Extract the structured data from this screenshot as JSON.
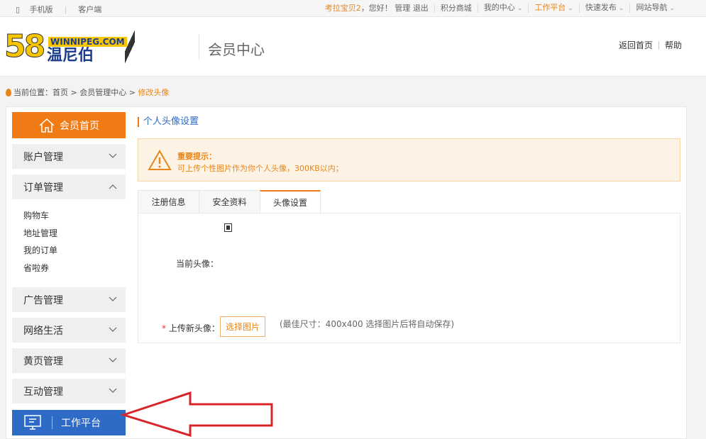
{
  "topbar": {
    "mobile": "手机版",
    "client": "客户端",
    "user": "考拉宝贝2",
    "greeting": "，您好！",
    "manage": "管理",
    "logout": "退出",
    "points": "积分商城",
    "mycenter": "我的中心",
    "workspace": "工作平台",
    "quickpost": "快速发布",
    "sitenav": "网站导航"
  },
  "header": {
    "logo_num": "58",
    "logo_web": "WINNIPEG.COM",
    "logo_cn": "温尼伯",
    "title": "会员中心",
    "home": "返回首页",
    "help": "帮助"
  },
  "breadcrumb": {
    "prefix": "当前位置：",
    "home": "首页",
    "center": "会员管理中心",
    "current": "修改头像"
  },
  "sidebar": {
    "home": "会员首页",
    "account": "账户管理",
    "orders": "订单管理",
    "order_items": [
      "购物车",
      "地址管理",
      "我的订单",
      "省啦券"
    ],
    "ads": "广告管理",
    "netlife": "网络生活",
    "yellow": "黄页管理",
    "interact": "互动管理",
    "work": "工作平台"
  },
  "content": {
    "section_title": "个人头像设置",
    "notice_title": "重要提示：",
    "notice_text": "可上传个性图片作为你个人头像，300KB以内；",
    "tabs": [
      "注册信息",
      "安全资料",
      "头像设置"
    ],
    "current_avatar_label": "当前头像：",
    "upload_req": "*",
    "upload_label": "上传新头像：",
    "choose_button": "选择图片",
    "hint": "(最佳尺寸：400x400 选择图片后将自动保存)"
  },
  "colors": {
    "accent": "#f07b14",
    "work_blue": "#2d6bc6",
    "annotation_red": "#d9232a"
  }
}
